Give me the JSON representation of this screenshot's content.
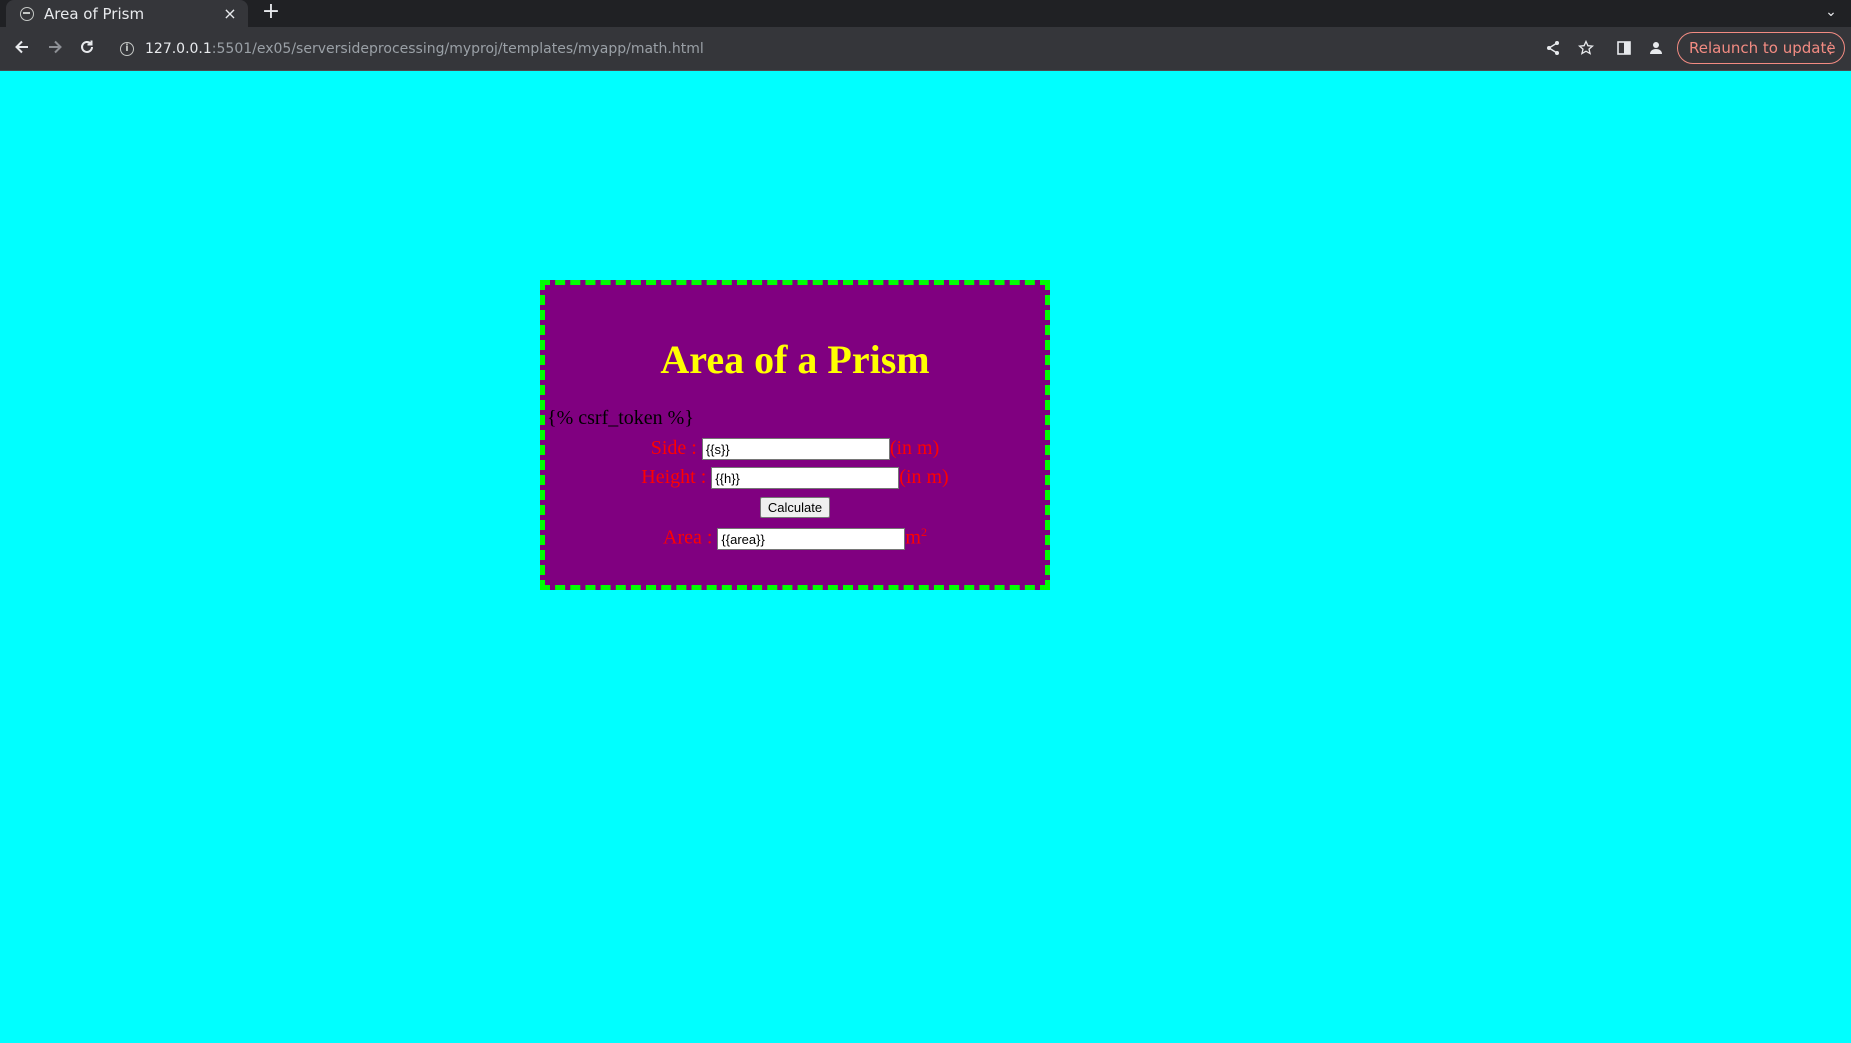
{
  "browser": {
    "tab_title": "Area of Prism",
    "tab_close": "×",
    "new_tab": "+",
    "tab_search": "⌄",
    "url_host": "127.0.0.1",
    "url_path": ":5501/ex05/serversideprocessing/myproj/templates/myapp/math.html",
    "relaunch_label": "Relaunch to update",
    "relaunch_menu": "⋮"
  },
  "page": {
    "title": "Area of a Prism",
    "csrf": "{% csrf_token %}",
    "side_label": "Side : ",
    "side_value": "{{s}}",
    "side_unit": "(in m)",
    "height_label": "Height : ",
    "height_value": "{{h}}",
    "height_unit": "(in m)",
    "calculate_label": "Calculate",
    "area_label": "Area : ",
    "area_value": "{{area}}",
    "area_unit": "m",
    "area_unit_exp": "2"
  },
  "colors": {
    "page_bg": "#00ffff",
    "box_bg": "#800080",
    "box_border": "#00ff00",
    "title": "#ffff00",
    "labels": "#ff0000"
  },
  "icons": [
    "globe-icon",
    "close-icon",
    "plus-icon",
    "back-icon",
    "forward-icon",
    "reload-icon",
    "info-icon",
    "share-icon",
    "star-icon",
    "side-panel-icon",
    "profile-icon",
    "menu-icon"
  ]
}
